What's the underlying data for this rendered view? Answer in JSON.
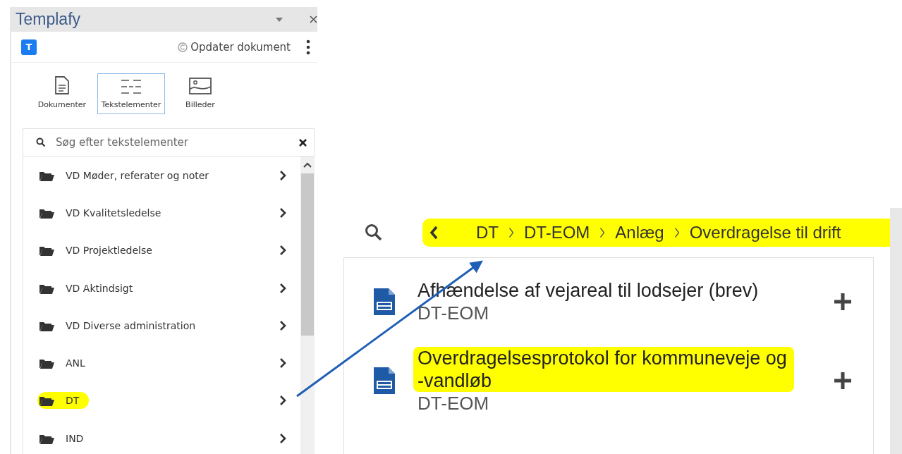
{
  "panel": {
    "title": "Templafy",
    "logo": "T",
    "update_button": "Opdater dokument",
    "tabs": [
      {
        "label": "Dokumenter",
        "kind": "document",
        "selected": false
      },
      {
        "label": "Tekstelementer",
        "kind": "text",
        "selected": true
      },
      {
        "label": "Billeder",
        "kind": "image",
        "selected": false
      }
    ],
    "search": {
      "placeholder": "Søg efter tekstelementer"
    },
    "folders": [
      {
        "label": "VD Møder, referater og noter",
        "highlighted": false
      },
      {
        "label": "VD Kvalitetsledelse",
        "highlighted": false
      },
      {
        "label": "VD Projektledelse",
        "highlighted": false
      },
      {
        "label": "VD Aktindsigt",
        "highlighted": false
      },
      {
        "label": "VD Diverse administration",
        "highlighted": false
      },
      {
        "label": "ANL",
        "highlighted": false
      },
      {
        "label": "DT",
        "highlighted": true
      },
      {
        "label": "IND",
        "highlighted": false
      }
    ]
  },
  "browser": {
    "breadcrumb": {
      "highlighted": true,
      "items": [
        "DT",
        "DT-EOM",
        "Anlæg",
        "Overdragelse til drift"
      ]
    },
    "results": [
      {
        "title": "Afhændelse af vejareal til lodsejer (brev)",
        "category": "DT-EOM",
        "highlighted": false
      },
      {
        "title": "Overdragelsesprotokol for kommuneveje og -vandløb",
        "category": "DT-EOM",
        "highlighted": true
      }
    ]
  }
}
